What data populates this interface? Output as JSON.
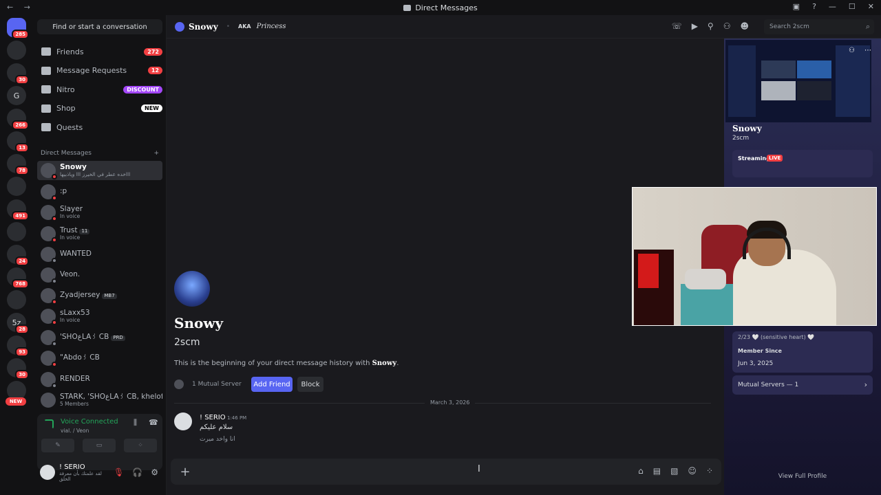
{
  "window": {
    "title": "Direct Messages",
    "nav": "← →"
  },
  "servers": [
    {
      "label": "",
      "badge": "285",
      "home": true
    },
    {
      "label": "",
      "badge": ""
    },
    {
      "label": "",
      "badge": "30"
    },
    {
      "label": "G",
      "badge": ""
    },
    {
      "label": "",
      "badge": "266"
    },
    {
      "label": "",
      "badge": "13"
    },
    {
      "label": "",
      "badge": "78"
    },
    {
      "label": "",
      "badge": ""
    },
    {
      "label": "",
      "badge": "491"
    },
    {
      "label": "",
      "badge": ""
    },
    {
      "label": "",
      "badge": "24"
    },
    {
      "label": "",
      "badge": "768"
    },
    {
      "label": "",
      "badge": ""
    },
    {
      "label": "5z",
      "badge": "28"
    },
    {
      "label": "",
      "badge": "93"
    },
    {
      "label": "",
      "badge": "30"
    },
    {
      "label": "",
      "badge": ""
    }
  ],
  "servers_new": "NEW",
  "find_button": "Find or start a conversation",
  "nav_items": [
    {
      "label": "Friends",
      "pill": "272",
      "kind": ""
    },
    {
      "label": "Message Requests",
      "pill": "12",
      "kind": ""
    },
    {
      "label": "Nitro",
      "pill": "DISCOUNT",
      "kind": "disc"
    },
    {
      "label": "Shop",
      "pill": "NEW",
      "kind": "new"
    },
    {
      "label": "Quests",
      "pill": "",
      "kind": ""
    }
  ],
  "dm_header": {
    "label": "Direct Messages",
    "add": "+"
  },
  "dms": [
    {
      "name": "Snowy",
      "sub": "اااخده عطر في الخيرز ااا وياذبيها",
      "tag": "",
      "status": "dnd",
      "active": true
    },
    {
      "name": ":p",
      "sub": "",
      "tag": "",
      "status": "dnd"
    },
    {
      "name": "Slayer",
      "sub": "In voice",
      "tag": "",
      "status": "dnd"
    },
    {
      "name": "Trust",
      "sub": "In voice",
      "tag": "11",
      "status": "dnd"
    },
    {
      "name": "WANTED",
      "sub": "",
      "tag": "",
      "status": "off"
    },
    {
      "name": "Veon.",
      "sub": "",
      "tag": "",
      "status": "off"
    },
    {
      "name": "Zyadjersey",
      "sub": "",
      "tag": "MB7",
      "status": "dnd"
    },
    {
      "name": "sLaxx53",
      "sub": "In voice",
      "tag": "",
      "status": "dnd"
    },
    {
      "name": "'SHOعLA꒱ CB",
      "sub": "",
      "tag": "PRD",
      "status": "off"
    },
    {
      "name": "\"Abdo꒱ CB",
      "sub": "",
      "tag": "",
      "status": "dnd"
    },
    {
      "name": "RENDER",
      "sub": "",
      "tag": "",
      "status": "off"
    },
    {
      "name": "STARK, 'SHOعLA꒱ CB, khelof...",
      "sub": "5 Members",
      "tag": "",
      "status": "none"
    }
  ],
  "voice": {
    "status": "Voice Connected",
    "channel": "vial. / Veon"
  },
  "user": {
    "name": "! SERIO",
    "status": "لقد علمتك بأن معرفة الخلق"
  },
  "header": {
    "name": "Snowy",
    "aka": "AKA",
    "nickname": "Princess"
  },
  "search": {
    "placeholder": "Search 2scm"
  },
  "intro": {
    "name": "Snowy",
    "username": "2scm",
    "text_prefix": "This is the beginning of your direct message history with ",
    "text_name": "Snowy",
    "text_suffix": ".",
    "mutual": "1 Mutual Server",
    "add_friend": "Add Friend",
    "block": "Block"
  },
  "divider_date": "March 3, 2026",
  "message": {
    "author": "! SERIO",
    "time": "1:46 PM",
    "line1": "سلام عليكم",
    "line2": "انا واخد ميرت"
  },
  "profile": {
    "name": "Snowy",
    "username": "2scm",
    "streaming": "Streaming",
    "live": "LIVE",
    "bio_fragment": "2/23   🤍 (sensitive heart) 🤍",
    "member_since_label": "Member Since",
    "member_since": "Jun 3, 2025",
    "mutual_servers": "Mutual Servers — 1",
    "view_full": "View Full Profile"
  },
  "colors": {
    "blurple": "#5865f2",
    "red": "#f23f42",
    "green": "#23a55a"
  }
}
